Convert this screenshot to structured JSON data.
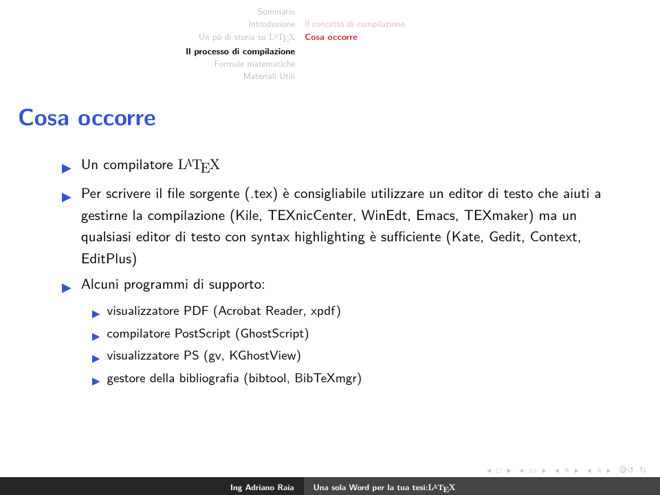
{
  "header": {
    "left": [
      "Sommario",
      "Introduzione",
      "Un pò di storia su LATEX",
      "Il processo di compilazione",
      "Formule matematiche",
      "Materiali Utili"
    ],
    "left_active_index": 3,
    "right": [
      "Il concetto di compilazione",
      "Cosa occorre"
    ],
    "right_active_index": 1
  },
  "title": "Cosa occorre",
  "bullets": [
    {
      "text": "Un compilatore LATEX"
    },
    {
      "text": "Per scrivere il file sorgente (.tex) è consigliabile utilizzare un editor di testo che aiuti a gestirne la compilazione (Kile, TEXnicCenter, WinEdt, Emacs, TEXmaker) ma un qualsiasi editor di testo con syntax highlighting è sufficiente (Kate, Gedit, Context, EditPlus)"
    },
    {
      "text": "Alcuni programmi di supporto:",
      "sub": [
        "visualizzatore PDF (Acrobat Reader, xpdf)",
        "compilatore PostScript (GhostScript)",
        "visualizzatore PS (gv, KGhostView)",
        "gestore della bibliografia (bibtool, BibTeXmgr)"
      ]
    }
  ],
  "footer": {
    "author": "Ing Adriano Raia",
    "talk": "Una sola Word per la tua tesi:LATEX"
  }
}
